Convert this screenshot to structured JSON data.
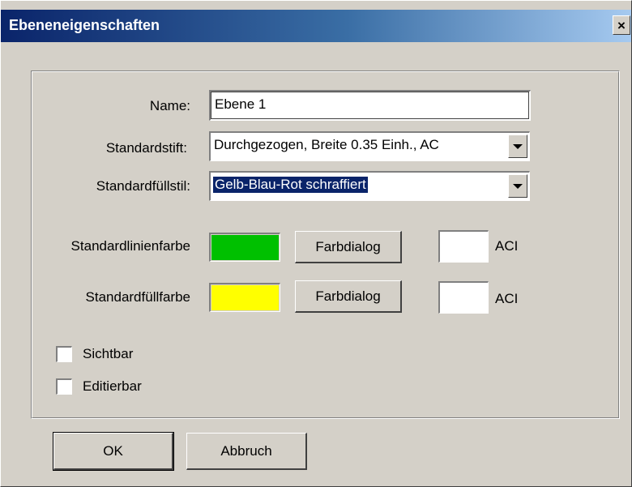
{
  "window": {
    "title": "Ebeneneigenschaften",
    "close_label": "×"
  },
  "form": {
    "name_label": "Name:",
    "name_value": "Ebene 1",
    "pen_label": "Standardstift:",
    "pen_value": "Durchgezogen, Breite 0.35 Einh., AC",
    "fill_style_label": "Standardfüllstil:",
    "fill_style_value": "Gelb-Blau-Rot schraffiert",
    "line_color_label": "Standardlinienfarbe",
    "line_color": "#00c000",
    "fill_color_label": "Standardfüllfarbe",
    "fill_color": "#ffff00",
    "color_dialog_label": "Farbdialog",
    "aci_label": "ACI",
    "visible_label": "Sichtbar",
    "visible_checked": false,
    "editable_label": "Editierbar",
    "editable_checked": false
  },
  "footer": {
    "ok_label": "OK",
    "cancel_label": "Abbruch"
  }
}
